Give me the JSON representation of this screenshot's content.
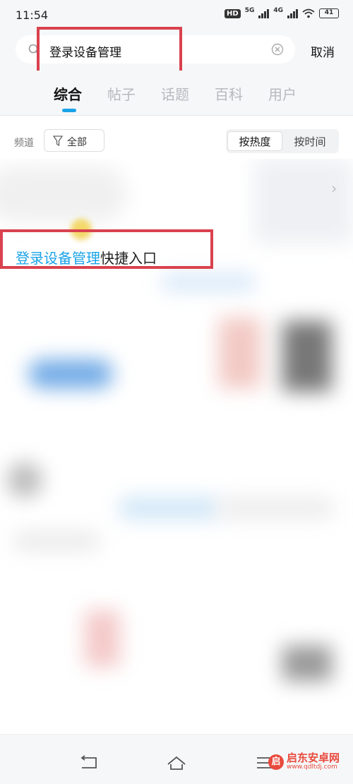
{
  "status_bar": {
    "time": "11:54",
    "hd_badge": "HD",
    "net1": "5G",
    "net2": "4G",
    "battery": "41",
    "icons": [
      "hd-icon",
      "signal-5g-icon",
      "signal-4g-icon",
      "wifi-icon",
      "battery-icon"
    ]
  },
  "search": {
    "query": "登录设备管理",
    "cancel_label": "取消",
    "icons": [
      "search-icon",
      "clear-icon"
    ]
  },
  "tabs": {
    "items": [
      {
        "label": "综合",
        "active": true
      },
      {
        "label": "帖子",
        "active": false
      },
      {
        "label": "话题",
        "active": false
      },
      {
        "label": "百科",
        "active": false
      },
      {
        "label": "用户",
        "active": false
      }
    ]
  },
  "filter": {
    "channel_label": "频道",
    "channel_value": "全部",
    "sort_options": [
      {
        "label": "按热度",
        "active": true
      },
      {
        "label": "按时间",
        "active": false
      }
    ]
  },
  "result": {
    "title_keyword": "登录设备管理",
    "title_rest": "快捷入口"
  },
  "nav": {
    "icons": [
      "back-icon",
      "home-icon",
      "menu-icon"
    ]
  },
  "watermark": {
    "logo_char": "启",
    "name": "启东安卓网",
    "url": "www.qdltdj.com"
  },
  "colors": {
    "accent": "#1aa3e8",
    "highlight_box": "#d9424e",
    "watermark": "#e84a3c"
  }
}
